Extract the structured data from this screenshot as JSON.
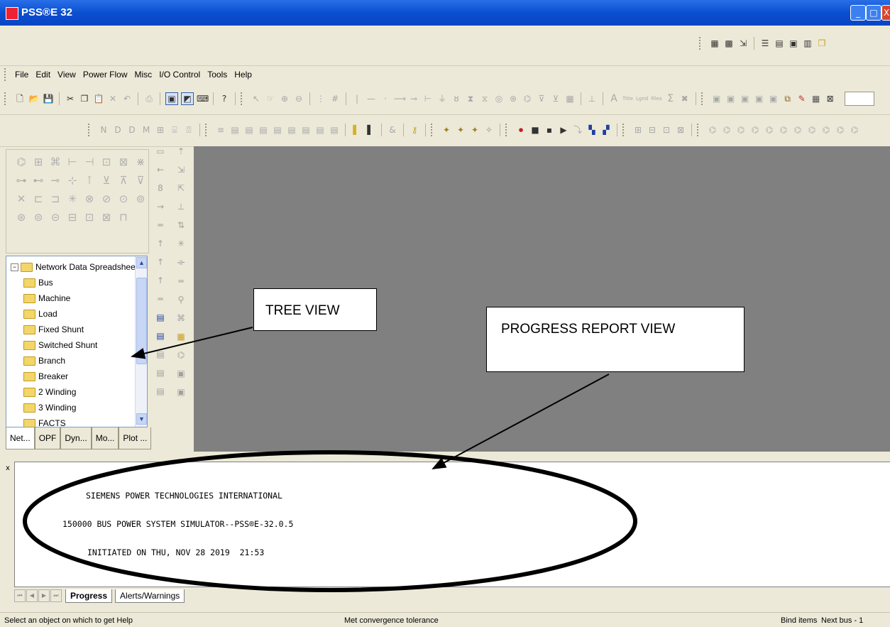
{
  "window": {
    "title": "PSS®E 32",
    "minimize": "_",
    "maximize": "□",
    "close": "X"
  },
  "menu": [
    "File",
    "Edit",
    "View",
    "Power Flow",
    "Misc",
    "I/O Control",
    "Tools",
    "Help"
  ],
  "toolbar_text": {
    "title_label": "Title",
    "legend_label": "Lgnd",
    "files_label": "Files",
    "sigma": "Σ",
    "letter_a": "A"
  },
  "tree": {
    "root": "Network Data Spreadsheet",
    "items": [
      "Bus",
      "Machine",
      "Load",
      "Fixed Shunt",
      "Switched Shunt",
      "Branch",
      "Breaker",
      "2 Winding",
      "3 Winding",
      "FACTS"
    ],
    "tabs": [
      "Net...",
      "OPF",
      "Dyn...",
      "Mo...",
      "Plot ..."
    ]
  },
  "progress_view": {
    "lines": [
      "SIEMENS POWER TECHNOLOGIES INTERNATIONAL",
      "150000 BUS POWER SYSTEM SIMULATOR--PSS®E-32.0.5",
      "INITIATED ON THU, NOV 28 2019  21:53"
    ],
    "tabs": [
      "Progress",
      "Alerts/Warnings"
    ],
    "close": "x"
  },
  "status": {
    "left": "Select an object on which to get Help",
    "middle": "Met convergence tolerance",
    "right1": "Bind items",
    "right2": "Next bus - 1"
  },
  "annotations": {
    "tree_view": "TREE VIEW",
    "progress_report_view": "PROGRESS REPORT VIEW"
  },
  "colors": {
    "title_bar": "#0a4fd0",
    "workspace": "#808080",
    "chrome": "#ece9d8"
  }
}
